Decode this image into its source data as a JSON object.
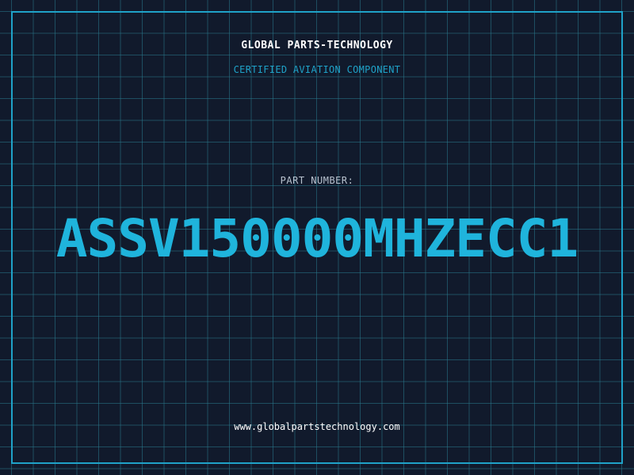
{
  "header": {
    "company": "GLOBAL PARTS-TECHNOLOGY",
    "subtitle": "CERTIFIED AVIATION COMPONENT"
  },
  "part": {
    "label": "PART NUMBER:",
    "number": "ASSV150000MHZECC1"
  },
  "footer": {
    "url": "www.globalpartstechnology.com"
  },
  "colors": {
    "background": "#111a2c",
    "accent": "#1fa2c8",
    "grid": "#28788c"
  }
}
